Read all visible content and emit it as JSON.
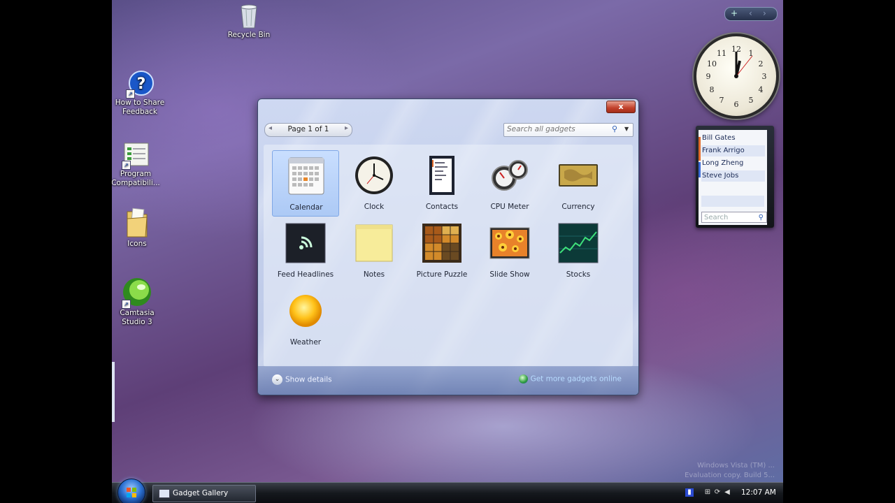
{
  "desktop": {
    "icons": [
      {
        "label": "Recycle Bin"
      },
      {
        "label": "How to Share Feedback"
      },
      {
        "label": "Program Compatibili..."
      },
      {
        "label": "Icons"
      },
      {
        "label": "Camtasia Studio 3"
      }
    ]
  },
  "sidebar": {
    "contacts": [
      "Bill Gates",
      "Frank Arrigo",
      "Long Zheng",
      "Steve Jobs"
    ],
    "contacts_search_placeholder": "Search"
  },
  "gallery": {
    "close_label": "x",
    "pager_label": "Page 1 of 1",
    "search_placeholder": "Search all gadgets",
    "gadgets": [
      {
        "label": "Calendar"
      },
      {
        "label": "Clock"
      },
      {
        "label": "Contacts"
      },
      {
        "label": "CPU Meter"
      },
      {
        "label": "Currency"
      },
      {
        "label": "Feed Headlines"
      },
      {
        "label": "Notes"
      },
      {
        "label": "Picture Puzzle"
      },
      {
        "label": "Slide Show"
      },
      {
        "label": "Stocks"
      },
      {
        "label": "Weather"
      }
    ],
    "selected": "Calendar",
    "show_details": "Show details",
    "get_more": "Get more gadgets online"
  },
  "watermark": {
    "line1": "Windows Vista (TM) ...",
    "line2": "Evaluation copy. Build 5..."
  },
  "taskbar": {
    "task_label": "Gadget Gallery",
    "time": "12:07 AM"
  }
}
